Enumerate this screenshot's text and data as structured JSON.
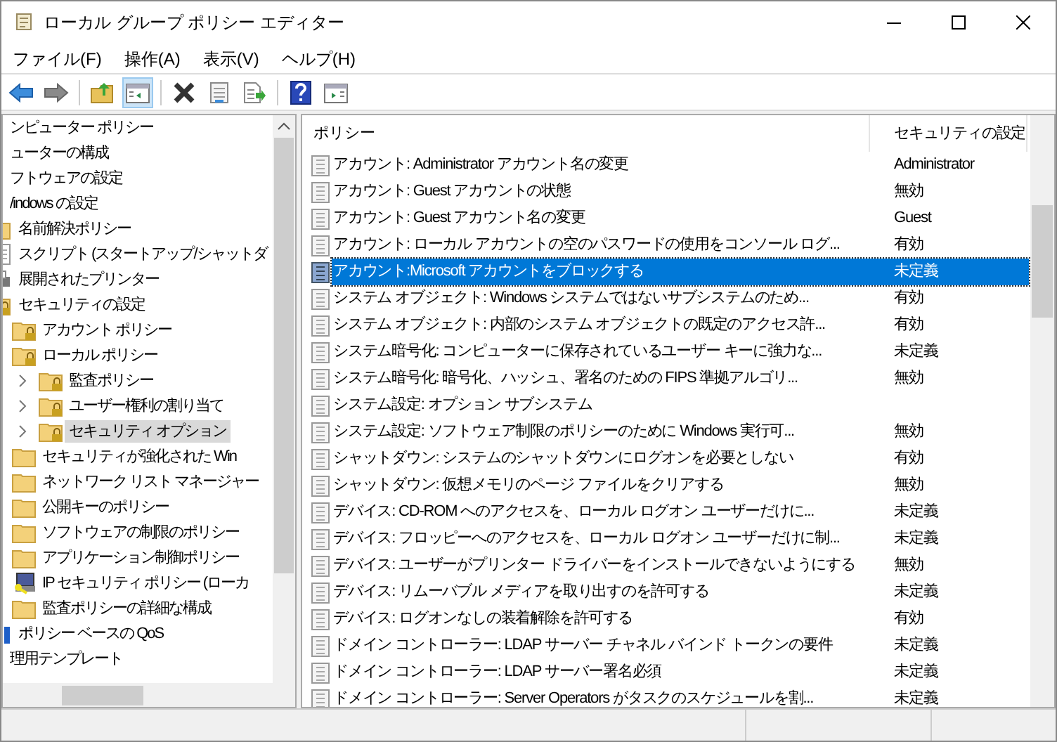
{
  "window": {
    "title": "ローカル グループ ポリシー エディター"
  },
  "menu": [
    "ファイル(F)",
    "操作(A)",
    "表示(V)",
    "ヘルプ(H)"
  ],
  "toolbar": [
    {
      "kind": "back",
      "pressed": false
    },
    {
      "kind": "forward",
      "pressed": false
    },
    {
      "kind": "separator"
    },
    {
      "kind": "up",
      "pressed": false
    },
    {
      "kind": "tree",
      "pressed": true
    },
    {
      "kind": "separator"
    },
    {
      "kind": "delete",
      "pressed": false
    },
    {
      "kind": "properties",
      "pressed": false
    },
    {
      "kind": "export",
      "pressed": false
    },
    {
      "kind": "separator"
    },
    {
      "kind": "help",
      "pressed": false
    },
    {
      "kind": "pane",
      "pressed": false
    }
  ],
  "tree": [
    {
      "label": "ンピューター ポリシー",
      "kind": "none",
      "selected": false,
      "children": [
        {
          "label": "ューターの構成",
          "kind": "none",
          "selected": false,
          "children": [
            {
              "label": "フトウェアの設定",
              "kind": "none",
              "selected": false
            },
            {
              "label": "/indows の設定",
              "kind": "none",
              "selected": false,
              "children": [
                {
                  "label": "名前解決ポリシー",
                  "kind": "folder",
                  "selected": false
                },
                {
                  "label": "スクリプト (スタートアップ/シャットダ",
                  "kind": "script",
                  "selected": false
                },
                {
                  "label": "展開されたプリンター",
                  "kind": "printer",
                  "selected": false
                },
                {
                  "label": "セキュリティの設定",
                  "kind": "lock-folder",
                  "selected": false,
                  "children": [
                    {
                      "label": "アカウント ポリシー",
                      "kind": "lock-folder",
                      "selected": false
                    },
                    {
                      "label": "ローカル ポリシー",
                      "kind": "lock-folder",
                      "selected": false,
                      "children": [
                        {
                          "label": "監査ポリシー",
                          "kind": "lock-folder",
                          "selected": false,
                          "expanded": false
                        },
                        {
                          "label": "ユーザー権利の割り当て",
                          "kind": "lock-folder",
                          "selected": false,
                          "expanded": false
                        },
                        {
                          "label": "セキュリティ オプション",
                          "kind": "lock-folder",
                          "selected": true,
                          "expanded": false
                        }
                      ]
                    },
                    {
                      "label": "セキュリティが強化された Win",
                      "kind": "folder",
                      "selected": false
                    },
                    {
                      "label": "ネットワーク リスト マネージャー",
                      "kind": "folder",
                      "selected": false
                    },
                    {
                      "label": "公開キーのポリシー",
                      "kind": "folder",
                      "selected": false
                    },
                    {
                      "label": "ソフトウェアの制限のポリシー",
                      "kind": "folder",
                      "selected": false
                    },
                    {
                      "label": "アプリケーション制御ポリシー",
                      "kind": "folder",
                      "selected": false
                    },
                    {
                      "label": "IP セキュリティ ポリシー (ローカ",
                      "kind": "ip",
                      "selected": false
                    },
                    {
                      "label": "監査ポリシーの詳細な構成",
                      "kind": "folder",
                      "selected": false
                    }
                  ]
                },
                {
                  "label": "ポリシー ベースの QoS",
                  "kind": "qos",
                  "selected": false
                }
              ]
            },
            {
              "label": "理用テンプレート",
              "kind": "none",
              "selected": false
            }
          ]
        }
      ]
    }
  ],
  "table": {
    "columns": [
      "ポリシー",
      "セキュリティの設定"
    ],
    "rows": [
      {
        "policy": "アカウント: Administrator アカウント名の変更",
        "setting": "Administrator",
        "selected": false
      },
      {
        "policy": "アカウント: Guest アカウントの状態",
        "setting": "無効",
        "selected": false
      },
      {
        "policy": "アカウント: Guest アカウント名の変更",
        "setting": "Guest",
        "selected": false
      },
      {
        "policy": "アカウント: ローカル アカウントの空のパスワードの使用をコンソール ログ...",
        "setting": "有効",
        "selected": false
      },
      {
        "policy": "アカウント:Microsoft アカウントをブロックする",
        "setting": "未定義",
        "selected": true
      },
      {
        "policy": "システム オブジェクト: Windows システムではないサブシステムのため...",
        "setting": "有効",
        "selected": false
      },
      {
        "policy": "システム オブジェクト: 内部のシステム オブジェクトの既定のアクセス許...",
        "setting": "有効",
        "selected": false
      },
      {
        "policy": "システム暗号化: コンピューターに保存されているユーザー キーに強力な...",
        "setting": "未定義",
        "selected": false
      },
      {
        "policy": "システム暗号化: 暗号化、ハッシュ、署名のための FIPS 準拠アルゴリ...",
        "setting": "無効",
        "selected": false
      },
      {
        "policy": "システム設定: オプション サブシステム",
        "selected": false
      },
      {
        "policy": "システム設定: ソフトウェア制限のポリシーのために Windows 実行可...",
        "setting": "無効",
        "selected": false
      },
      {
        "policy": "シャットダウン: システムのシャットダウンにログオンを必要としない",
        "setting": "有効",
        "selected": false
      },
      {
        "policy": "シャットダウン: 仮想メモリのページ ファイルをクリアする",
        "setting": "無効",
        "selected": false
      },
      {
        "policy": "デバイス: CD-ROM へのアクセスを、ローカル ログオン ユーザーだけに...",
        "setting": "未定義",
        "selected": false
      },
      {
        "policy": "デバイス: フロッピーへのアクセスを、ローカル ログオン ユーザーだけに制...",
        "setting": "未定義",
        "selected": false
      },
      {
        "policy": "デバイス: ユーザーがプリンター ドライバーをインストールできないようにする",
        "setting": "無効",
        "selected": false
      },
      {
        "policy": "デバイス: リムーバブル メディアを取り出すのを許可する",
        "setting": "未定義",
        "selected": false
      },
      {
        "policy": "デバイス: ログオンなしの装着解除を許可する",
        "setting": "有効",
        "selected": false
      },
      {
        "policy": "ドメイン コントローラー: LDAP サーバー チャネル バインド トークンの要件",
        "setting": "未定義",
        "selected": false
      },
      {
        "policy": "ドメイン コントローラー: LDAP サーバー署名必須",
        "setting": "未定義",
        "selected": false
      },
      {
        "policy": "ドメイン コントローラー: Server Operators がタスクのスケジュールを割...",
        "setting": "未定義",
        "selected": false
      }
    ]
  }
}
